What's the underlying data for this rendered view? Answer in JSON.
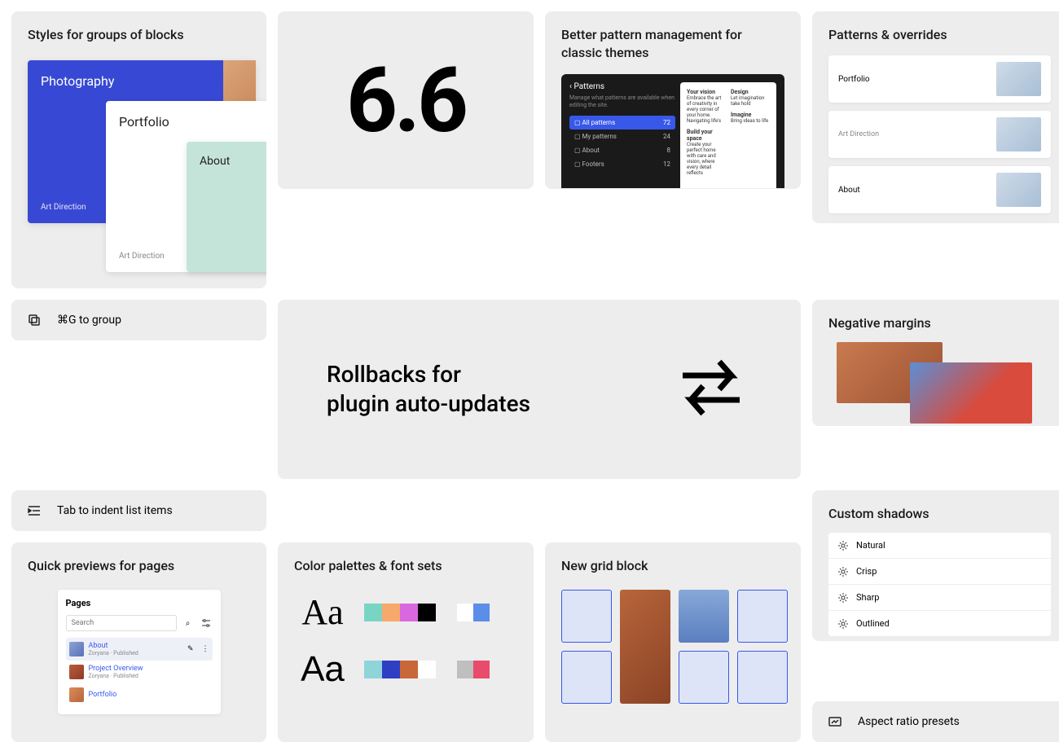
{
  "styles_groups": {
    "title": "Styles for groups of blocks",
    "cards": {
      "blue": {
        "title": "Photography",
        "sub": "Art Direction"
      },
      "white": {
        "title": "Portfolio",
        "sub": "Art Direction"
      },
      "mint": {
        "title": "About"
      }
    }
  },
  "version_number": "6.6",
  "pattern_mgmt": {
    "title": "Better pattern management for classic themes",
    "sidebar": {
      "back": "Patterns",
      "hint": "Manage what patterns are available when editing the site.",
      "items": [
        {
          "label": "All patterns",
          "count": "72",
          "active": true
        },
        {
          "label": "My patterns",
          "count": "24"
        },
        {
          "label": "About",
          "count": "8"
        },
        {
          "label": "Footers",
          "count": "12"
        }
      ]
    },
    "docs": {
      "col1": [
        {
          "h": "Your vision",
          "t": "Embrace the art of creativity in every corner of your home. Navigating life's"
        },
        {
          "h": "Build your space",
          "t": "Create your perfect home with care and vision, where every detail reflects"
        }
      ],
      "col2": [
        {
          "h": "Design",
          "t": "Let imagination take hold"
        },
        {
          "h": "Imagine",
          "t": "Bring ideas to life"
        }
      ]
    }
  },
  "rollbacks": {
    "title_l1": "Rollbacks for",
    "title_l2": "plugin auto-updates"
  },
  "tip_group": {
    "label": "⌘G to group"
  },
  "tip_indent": {
    "label": "Tab to indent list items"
  },
  "quick_previews": {
    "title": "Quick previews for pages",
    "panel_title": "Pages",
    "search_placeholder": "Search",
    "pages": [
      {
        "name": "About",
        "meta": "Zoryana · Published",
        "active": true,
        "thumb": "t1"
      },
      {
        "name": "Project Overview",
        "meta": "Zoryana · Published",
        "thumb": "t2"
      },
      {
        "name": "Portfolio",
        "meta": "",
        "thumb": "t3"
      }
    ]
  },
  "palettes": {
    "title": "Color palettes & font sets",
    "sample": "Aa",
    "row1": {
      "main": [
        "#7ad4c4",
        "#f7a86b",
        "#d968e0",
        "#000000"
      ],
      "accent": [
        "#ffffff",
        "#5a8ee8"
      ]
    },
    "row2": {
      "main": [
        "#8fd4d9",
        "#2e3fc4",
        "#c9663a",
        "#ffffff"
      ],
      "accent": [
        "#bfbfbf",
        "#e84b6b"
      ]
    }
  },
  "new_grid": {
    "title": "New grid block"
  },
  "overrides": {
    "title": "Patterns & overrides",
    "cards": [
      {
        "label": "Portfolio"
      },
      {
        "label": "Art Direction",
        "is_sub": true
      },
      {
        "label": "About"
      }
    ]
  },
  "neg_margins": {
    "title": "Negative margins"
  },
  "shadows": {
    "title": "Custom shadows",
    "items": [
      "Natural",
      "Crisp",
      "Sharp",
      "Outlined"
    ]
  },
  "aspect": {
    "title": "Aspect ratio presets"
  }
}
